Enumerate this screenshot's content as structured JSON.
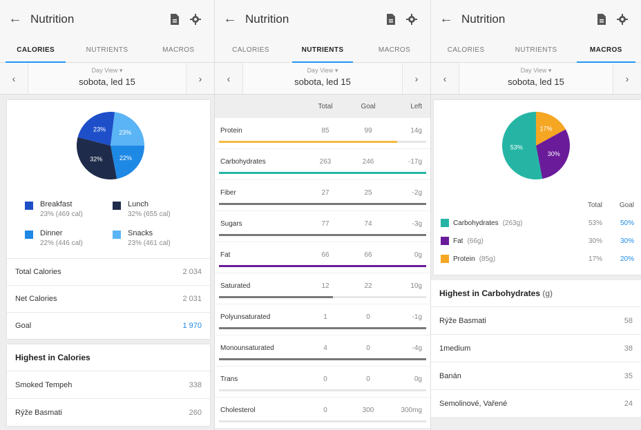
{
  "app": {
    "title": "Nutrition",
    "back_icon": "back-arrow-icon",
    "report_icon": "document-icon",
    "settings_icon": "gear-icon"
  },
  "tabs": [
    "CALORIES",
    "NUTRIENTS",
    "MACROS"
  ],
  "day": {
    "view_label": "Day View ▾",
    "date": "sobota, led 15"
  },
  "colors": {
    "breakfast": "#1e4fc9",
    "lunch": "#1e2b4a",
    "dinner": "#1e88e5",
    "snacks": "#5ab4f5",
    "carbs": "#26b5a5",
    "fat": "#6a1b9a",
    "protein": "#f5a623",
    "accent": "#2196f3"
  },
  "calories": {
    "pie": [
      {
        "name": "Breakfast",
        "pct": 23,
        "label": "23%"
      },
      {
        "name": "Snacks",
        "pct": 23,
        "label": "23%"
      },
      {
        "name": "Dinner",
        "pct": 22,
        "label": "22%"
      },
      {
        "name": "Lunch",
        "pct": 32,
        "label": "32%"
      }
    ],
    "legend": [
      {
        "name": "Breakfast",
        "sub": "23% (469 cal)",
        "key": "breakfast"
      },
      {
        "name": "Lunch",
        "sub": "32% (655 cal)",
        "key": "lunch"
      },
      {
        "name": "Dinner",
        "sub": "22% (446 cal)",
        "key": "dinner"
      },
      {
        "name": "Snacks",
        "sub": "23% (461 cal)",
        "key": "snacks"
      }
    ],
    "summary": [
      {
        "label": "Total Calories",
        "value": "2 034"
      },
      {
        "label": "Net Calories",
        "value": "2 031"
      },
      {
        "label": "Goal",
        "value": "1 970"
      }
    ],
    "highest_title": "Highest in Calories",
    "highest": [
      {
        "name": "Smoked Tempeh",
        "value": "338"
      },
      {
        "name": "Rýže Basmati",
        "value": "260"
      }
    ]
  },
  "nutrients": {
    "headers": [
      "",
      "Total",
      "Goal",
      "Left"
    ],
    "rows": [
      {
        "name": "Protein",
        "total": "85",
        "goal": "99",
        "left": "14g",
        "progress": 0.86,
        "color": "#f5b942"
      },
      {
        "name": "Carbohydrates",
        "total": "263",
        "goal": "246",
        "left": "-17g",
        "progress": 1.0,
        "color": "#26b5a5"
      },
      {
        "name": "Fiber",
        "total": "27",
        "goal": "25",
        "left": "-2g",
        "progress": 1.0,
        "color": "#777777"
      },
      {
        "name": "Sugars",
        "total": "77",
        "goal": "74",
        "left": "-3g",
        "progress": 1.0,
        "color": "#777777"
      },
      {
        "name": "Fat",
        "total": "66",
        "goal": "66",
        "left": "0g",
        "progress": 1.0,
        "color": "#6a1b9a"
      },
      {
        "name": "Saturated",
        "total": "12",
        "goal": "22",
        "left": "10g",
        "progress": 0.55,
        "color": "#777777"
      },
      {
        "name": "Polyunsaturated",
        "total": "1",
        "goal": "0",
        "left": "-1g",
        "progress": 1.0,
        "color": "#777777"
      },
      {
        "name": "Monounsaturated",
        "total": "4",
        "goal": "0",
        "left": "-4g",
        "progress": 1.0,
        "color": "#777777"
      },
      {
        "name": "Trans",
        "total": "0",
        "goal": "0",
        "left": "0g",
        "progress": 0,
        "color": "#777777"
      },
      {
        "name": "Cholesterol",
        "total": "0",
        "goal": "300",
        "left": "300mg",
        "progress": 0,
        "color": "#777777"
      }
    ]
  },
  "macros": {
    "pie": [
      {
        "name": "Protein",
        "pct": 17,
        "label": "17%"
      },
      {
        "name": "Fat",
        "pct": 30,
        "label": "30%"
      },
      {
        "name": "Carbohydrates",
        "pct": 53,
        "label": "53%"
      }
    ],
    "headers": [
      "",
      "Total",
      "Goal"
    ],
    "rows": [
      {
        "name": "Carbohydrates",
        "amount": "(263g)",
        "total": "53%",
        "goal": "50%",
        "key": "carbs"
      },
      {
        "name": "Fat",
        "amount": "(66g)",
        "total": "30%",
        "goal": "30%",
        "key": "fat"
      },
      {
        "name": "Protein",
        "amount": "(85g)",
        "total": "17%",
        "goal": "20%",
        "key": "protein"
      }
    ],
    "highest_title": "Highest in Carbohydrates",
    "highest_unit": "(g)",
    "highest": [
      {
        "name": "Rýže Basmati",
        "value": "58"
      },
      {
        "name": "1medium",
        "value": "38"
      },
      {
        "name": "Banán",
        "value": "35"
      },
      {
        "name": "Semolinové, Vařené",
        "value": "24"
      }
    ]
  }
}
